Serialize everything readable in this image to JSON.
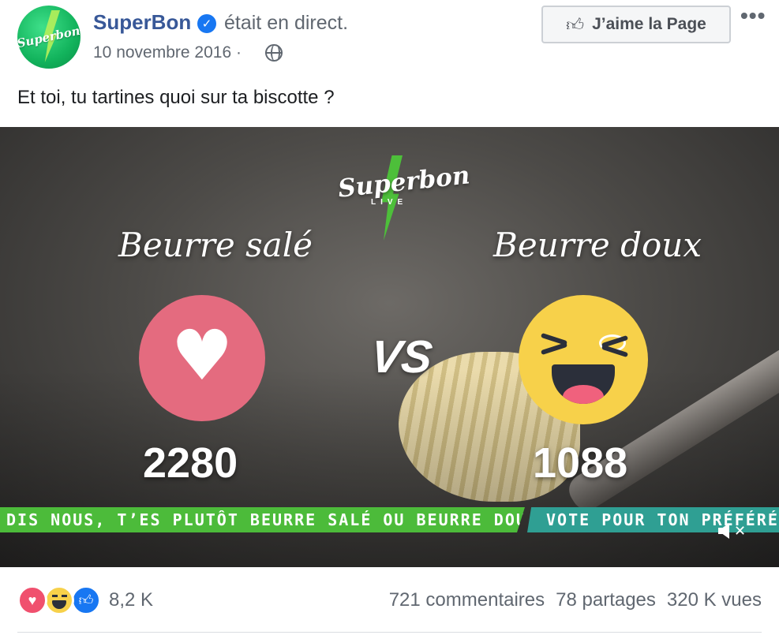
{
  "post": {
    "page_name": "SuperBon",
    "live_status": "était en direct.",
    "date": "10 novembre 2016 ·",
    "like_page_label": "J’aime la Page",
    "more_label": "•••",
    "caption": "Et toi, tu tartines quoi sur ta biscotte ?",
    "avatar_logo_text": "Superbon",
    "icons": [
      "verified-badge-icon",
      "globe-icon",
      "thumbs-up-icon",
      "more-options-icon"
    ]
  },
  "video": {
    "logo_text": "Superbon",
    "logo_sub": "LIVE",
    "left_title": "Beurre salé",
    "right_title": "Beurre doux",
    "vs_label": "VS",
    "left_count": "2280",
    "right_count": "1088",
    "banner_left": "DIS NOUS, T’ES PLUTÔT BEURRE SALÉ OU BEURRE DOUX ?",
    "banner_right": "VOTE POUR TON PRÉFÉRÉ !",
    "left_reaction": "love",
    "right_reaction": "haha",
    "colors": {
      "love": "#e46b7f",
      "haha": "#f7d14a",
      "banner_green": "#4cbb3a",
      "banner_teal": "#2f9f93"
    },
    "muted": true
  },
  "footer": {
    "reaction_count": "8,2 K",
    "comments": "721 commentaires",
    "shares": "78 partages",
    "views": "320 K vues",
    "reactions": [
      "love",
      "haha",
      "like"
    ]
  }
}
